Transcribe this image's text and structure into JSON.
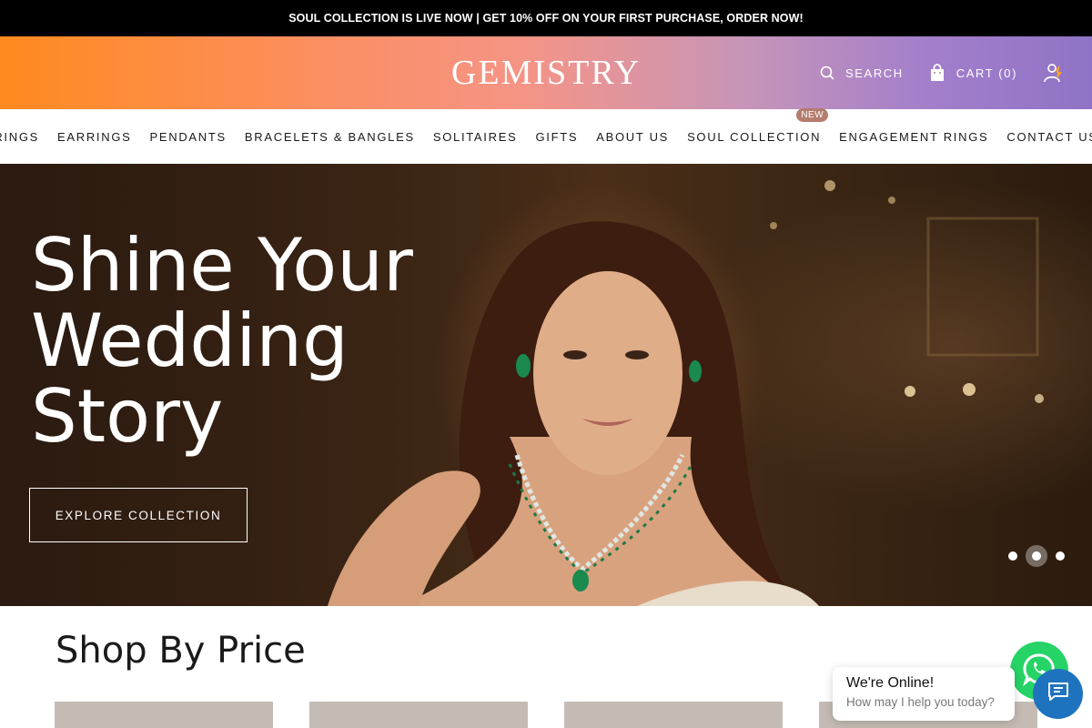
{
  "announcement": "SOUL COLLECTION IS LIVE NOW | GET 10% OFF ON YOUR FIRST PURCHASE, ORDER NOW!",
  "header": {
    "logo": "GEMISTRY",
    "search_label": "SEARCH",
    "cart_label": "CART (0)"
  },
  "nav": {
    "items": [
      "RINGS",
      "EARRINGS",
      "PENDANTS",
      "BRACELETS & BANGLES",
      "SOLITAIRES",
      "GIFTS",
      "ABOUT US",
      "SOUL COLLECTION",
      "ENGAGEMENT RINGS",
      "CONTACT US"
    ],
    "badge": "NEW"
  },
  "hero": {
    "title_lines": [
      "Shine Your",
      "Wedding",
      "Story"
    ],
    "cta": "EXPLORE COLLECTION",
    "slides": 3,
    "active_slide": 2
  },
  "shop_by_price": {
    "title": "Shop By Price"
  },
  "chat": {
    "title": "We're Online!",
    "subtitle": "How may I help you today?"
  },
  "colors": {
    "announcement_bg": "#000000",
    "header_gradient": [
      "#ff8a1f",
      "#f59486",
      "#8f73c6"
    ],
    "badge": "#b47c6f",
    "whatsapp": "#25d366",
    "chat": "#1e73be"
  },
  "icons": [
    "search-icon",
    "cart-icon",
    "user-icon",
    "whatsapp-icon",
    "chat-icon"
  ]
}
